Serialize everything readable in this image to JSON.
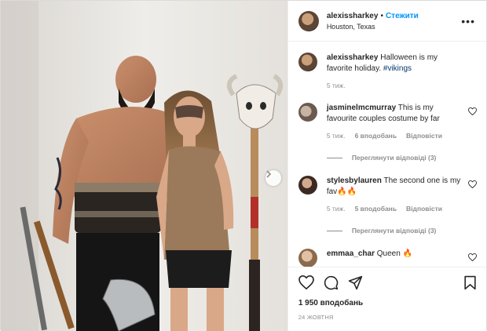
{
  "header": {
    "username": "alexissharkey",
    "dot": "•",
    "follow_label": "Стежити",
    "location": "Houston, Texas",
    "more_label": "•••"
  },
  "caption": {
    "username": "alexissharkey",
    "text": " Halloween is my favorite holiday. ",
    "hashtag": "#vikings",
    "time": "5 тиж."
  },
  "comments": [
    {
      "username": "jasminelmcmurray",
      "text": " This is my favourite couples costume by far",
      "time": "5 тиж.",
      "likes": "6 вподобань",
      "reply": "Відповісти",
      "view_replies": "Переглянути відповіді (3)"
    },
    {
      "username": "stylesbylauren",
      "text": " The second one is my fav🔥🔥",
      "time": "5 тиж.",
      "likes": "5 вподобань",
      "reply": "Відповісти",
      "view_replies": "Переглянути відповіді (3)"
    },
    {
      "username": "emmaa_char",
      "text": " Queen 🔥"
    }
  ],
  "footer": {
    "likes": "1 950 вподобань",
    "date": "24 жовтня"
  },
  "icons": {
    "heart": "heart-icon",
    "comment": "comment-icon",
    "share": "share-icon",
    "save": "bookmark-icon",
    "next": "chevron-right-icon"
  },
  "colors": {
    "follow": "#0095f6",
    "secondary_text": "#8e8e8e",
    "border": "#dbdbdb",
    "hashtag": "#00376b"
  }
}
